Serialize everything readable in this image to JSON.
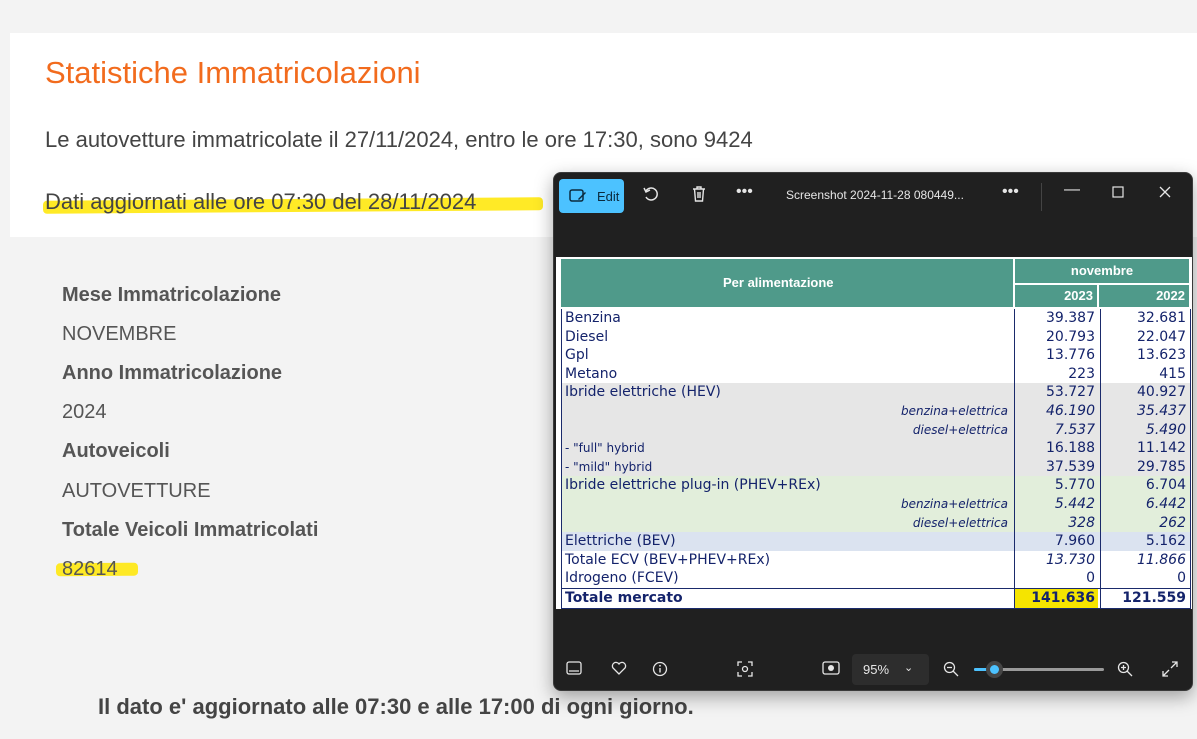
{
  "page": {
    "title": "Statistiche Immatricolazioni",
    "summary": "Le autovetture immatricolate il 27/11/2024, entro le ore 17:30, sono 9424",
    "updated": "Dati aggiornati alle ore 07:30 del 28/11/2024",
    "fields": [
      {
        "label": "Mese Immatricolazione",
        "value": "NOVEMBRE"
      },
      {
        "label": "Anno Immatricolazione",
        "value": "2024"
      },
      {
        "label": "Autoveicoli",
        "value": "AUTOVETTURE"
      },
      {
        "label": "Totale Veicoli Immatricolati",
        "value": "82614"
      }
    ],
    "footer": "Il dato e' aggiornato alle 07:30 e alle 17:00 di ogni giorno.",
    "accent_color": "#f26b1d",
    "highlight_color": "#ffe600"
  },
  "viewer": {
    "edit_label": "Edit",
    "file_name": "Screenshot 2024-11-28 080449...",
    "zoom": "95%",
    "icons": {
      "edit": "edit-image-icon",
      "rotate": "rotate-icon",
      "delete": "trash-icon",
      "more": "more-icon",
      "minimize": "minimize-icon",
      "maximize": "maximize-icon",
      "close": "close-icon",
      "filmstrip": "filmstrip-icon",
      "favorite": "heart-icon",
      "info": "info-icon",
      "crop": "focus-icon",
      "actual_size": "actual-size-icon",
      "zoom_out": "zoom-out-icon",
      "zoom_in": "zoom-in-icon",
      "fullscreen": "fullscreen-icon"
    },
    "table": {
      "header_main": "Per alimentazione",
      "header_month": "novembre",
      "years": [
        "2023",
        "2022"
      ],
      "rows": [
        {
          "label": "Benzina",
          "v1": "39.387",
          "v2": "32.681",
          "style": ""
        },
        {
          "label": "Diesel",
          "v1": "20.793",
          "v2": "22.047",
          "style": ""
        },
        {
          "label": "Gpl",
          "v1": "13.776",
          "v2": "13.623",
          "style": ""
        },
        {
          "label": "Metano",
          "v1": "223",
          "v2": "415",
          "style": ""
        },
        {
          "label": "Ibride elettriche (HEV)",
          "v1": "53.727",
          "v2": "40.927",
          "style": "gray"
        },
        {
          "label": "benzina+elettrica",
          "v1": "46.190",
          "v2": "35.437",
          "style": "gray sub"
        },
        {
          "label": "diesel+elettrica",
          "v1": "7.537",
          "v2": "5.490",
          "style": "gray sub"
        },
        {
          "label": "- \"full\" hybrid",
          "v1": "16.188",
          "v2": "11.142",
          "style": "gray small"
        },
        {
          "label": "- \"mild\" hybrid",
          "v1": "37.539",
          "v2": "29.785",
          "style": "gray small"
        },
        {
          "label": "Ibride elettriche plug-in (PHEV+REx)",
          "v1": "5.770",
          "v2": "6.704",
          "style": "green"
        },
        {
          "label": "benzina+elettrica",
          "v1": "5.442",
          "v2": "6.442",
          "style": "green sub"
        },
        {
          "label": "diesel+elettrica",
          "v1": "328",
          "v2": "262",
          "style": "green sub"
        },
        {
          "label": "Elettriche (BEV)",
          "v1": "7.960",
          "v2": "5.162",
          "style": "blue"
        },
        {
          "label": "Totale ECV (BEV+PHEV+REx)",
          "v1": "13.730",
          "v2": "11.866",
          "style": "sub-num"
        },
        {
          "label": "Idrogeno (FCEV)",
          "v1": "0",
          "v2": "0",
          "style": ""
        },
        {
          "label": "Totale mercato",
          "v1": "141.636",
          "v2": "121.559",
          "style": "total"
        }
      ]
    }
  }
}
